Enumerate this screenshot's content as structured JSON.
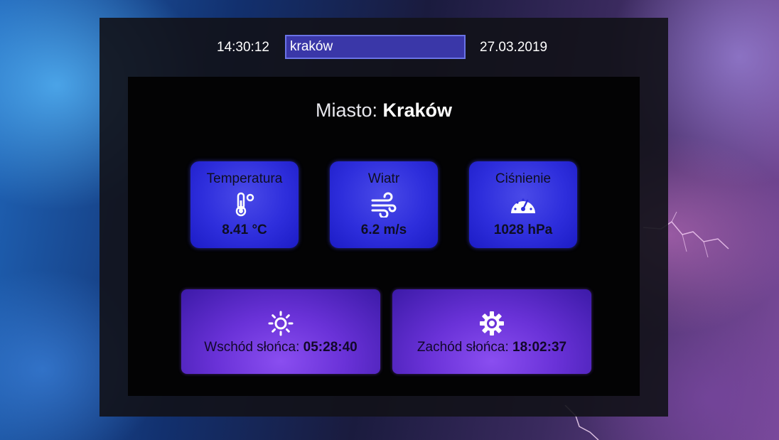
{
  "header": {
    "time": "14:30:12",
    "search_value": "kraków",
    "date": "27.03.2019"
  },
  "city": {
    "label": "Miasto:",
    "name": "Kraków"
  },
  "cards": {
    "temperature": {
      "title": "Temperatura",
      "value": "8.41 °C",
      "icon": "thermometer-icon"
    },
    "wind": {
      "title": "Wiatr",
      "value": "6.2 m/s",
      "icon": "wind-icon"
    },
    "pressure": {
      "title": "Ciśnienie",
      "value": "1028 hPa",
      "icon": "gauge-icon"
    }
  },
  "sun": {
    "sunrise": {
      "label": "Wschód słońca:",
      "value": "05:28:40",
      "icon": "sun-icon"
    },
    "sunset": {
      "label": "Zachód słońca:",
      "value": "18:02:37",
      "icon": "cog-sun-icon"
    }
  },
  "colors": {
    "card_blue": "#2e2edc",
    "card_purple": "#6a32d8",
    "panel_dark": "#030304",
    "search_bg": "#3a37a8"
  }
}
